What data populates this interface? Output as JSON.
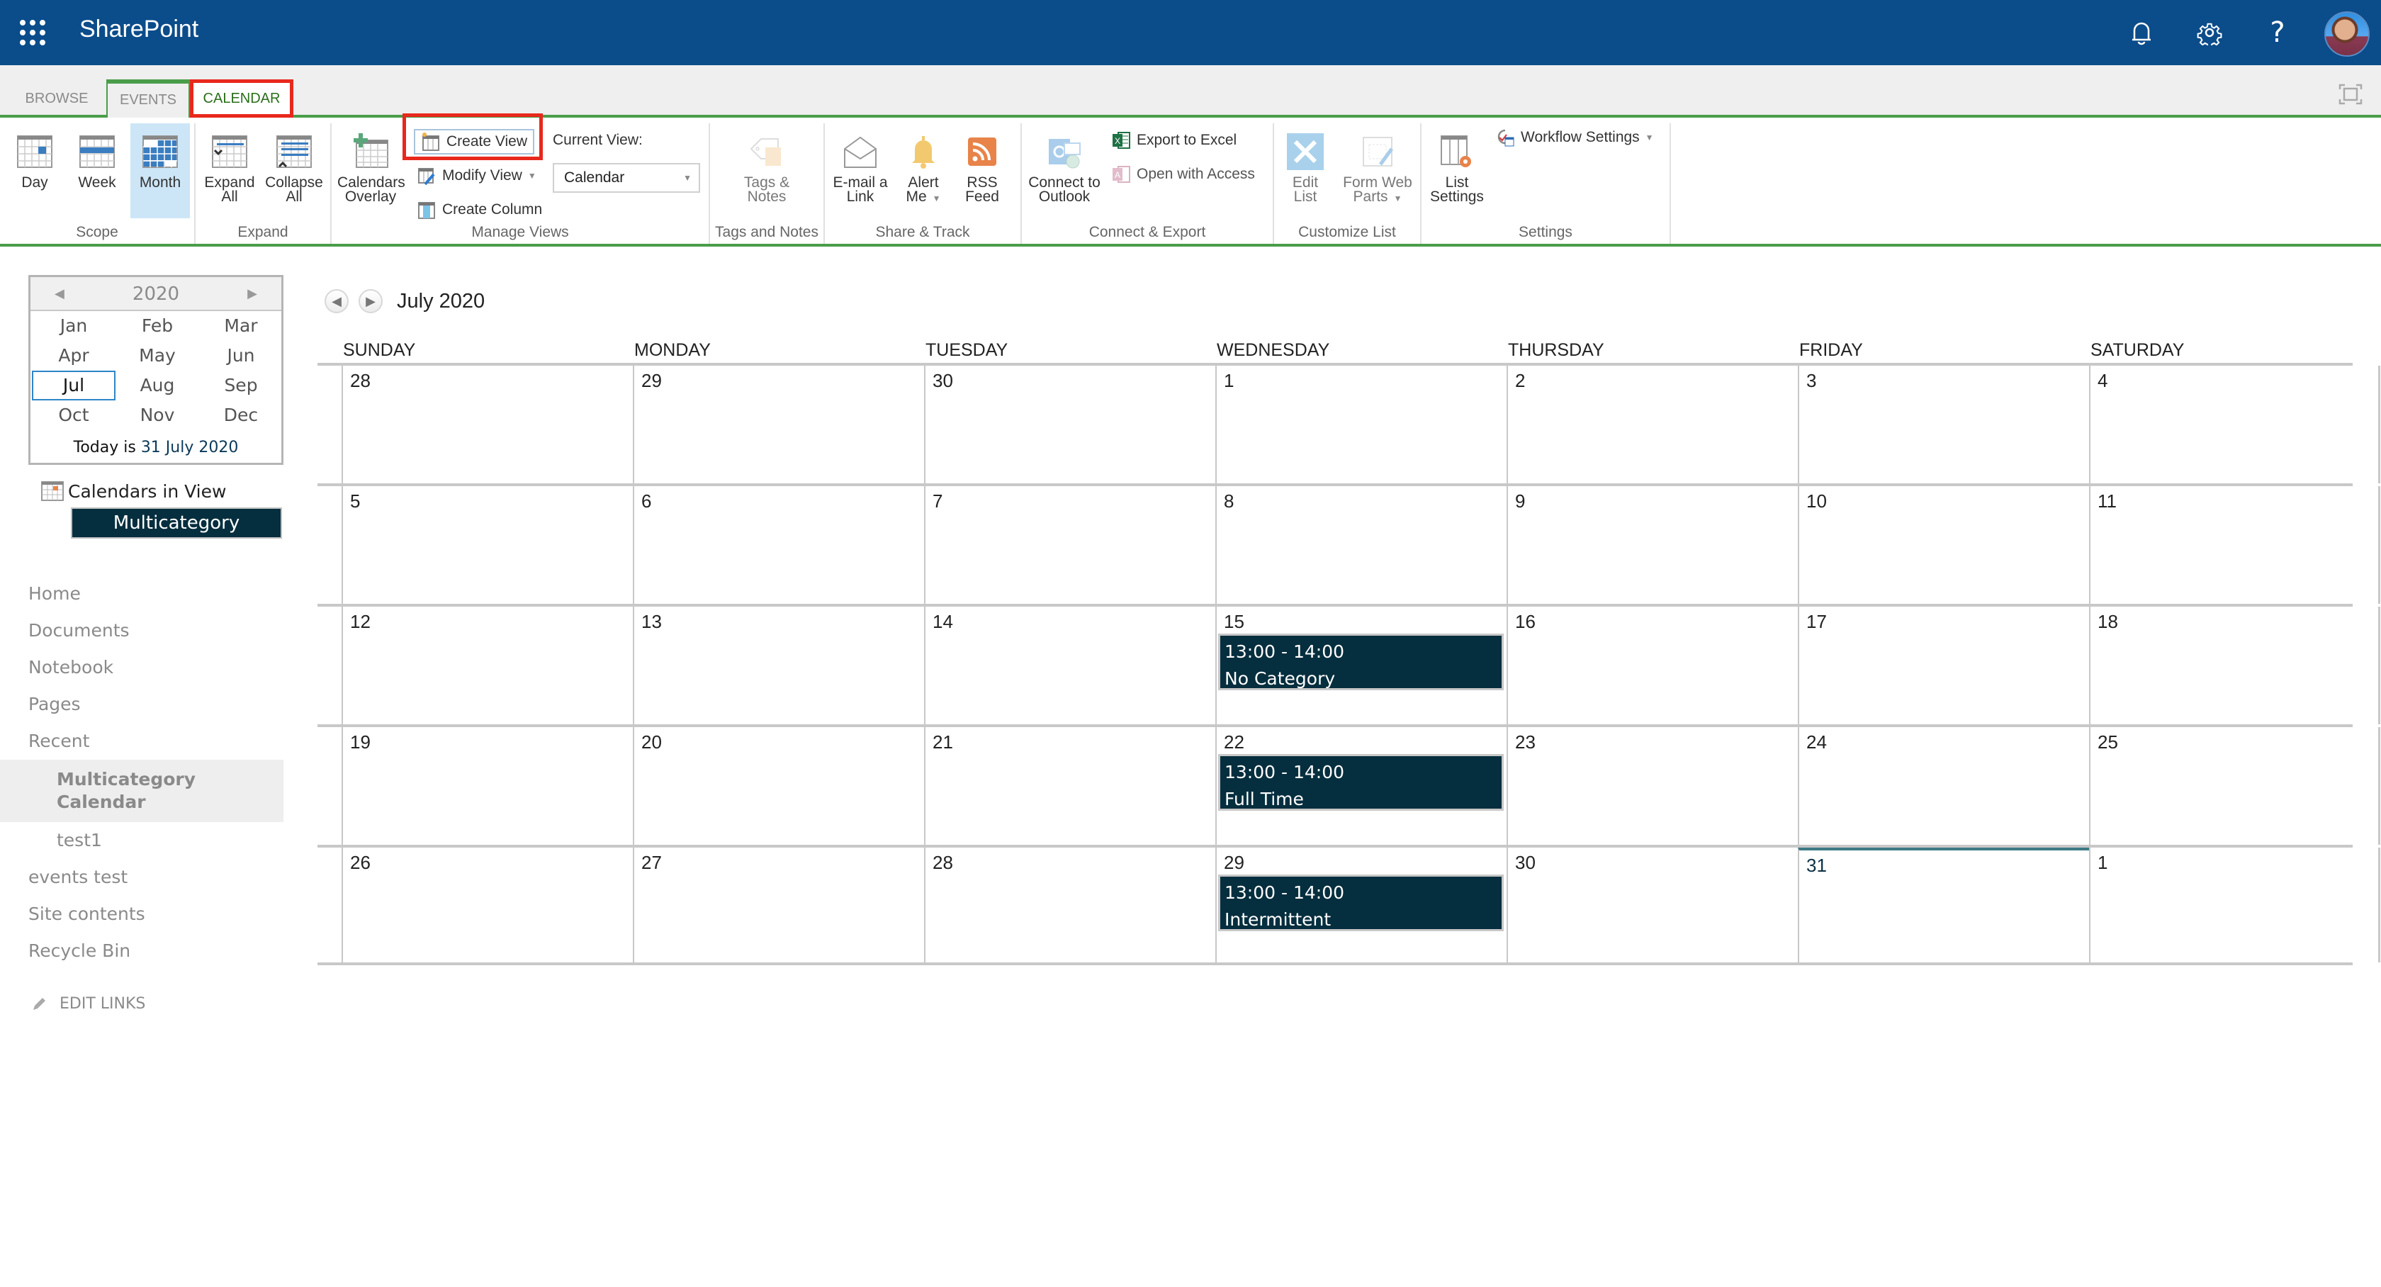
{
  "app": {
    "brand": "SharePoint",
    "suite_icons": [
      "bell-icon",
      "gear-icon",
      "help-icon"
    ],
    "help_glyph": "?"
  },
  "tabs": [
    {
      "label": "BROWSE",
      "active": false
    },
    {
      "label": "EVENTS",
      "active": false
    },
    {
      "label": "CALENDAR",
      "active": true
    }
  ],
  "ribbon": {
    "groups": {
      "scope": "Scope",
      "expand": "Expand",
      "manage_views": "Manage Views",
      "tags_notes": "Tags and Notes",
      "share_track": "Share & Track",
      "connect_export": "Connect & Export",
      "customize_list": "Customize List",
      "settings": "Settings"
    },
    "scope": {
      "day": "Day",
      "week": "Week",
      "month": "Month",
      "selected": "Month"
    },
    "expand": {
      "expand_all_1": "Expand",
      "expand_all_2": "All",
      "collapse_all_1": "Collapse",
      "collapse_all_2": "All"
    },
    "manage_views": {
      "calendars_overlay_1": "Calendars",
      "calendars_overlay_2": "Overlay",
      "create_view": "Create View",
      "modify_view": "Modify View",
      "create_column": "Create Column",
      "current_view_label": "Current View:",
      "current_view_value": "Calendar"
    },
    "tags_notes": {
      "line1": "Tags &",
      "line2": "Notes"
    },
    "share_track": {
      "email_1": "E-mail a",
      "email_2": "Link",
      "alert_1": "Alert",
      "alert_2": "Me",
      "rss_1": "RSS",
      "rss_2": "Feed"
    },
    "connect_export": {
      "outlook_1": "Connect to",
      "outlook_2": "Outlook",
      "export_excel": "Export to Excel",
      "open_access": "Open with Access"
    },
    "customize_list": {
      "edit_list_1": "Edit",
      "edit_list_2": "List",
      "form_web_parts_1": "Form Web",
      "form_web_parts_2": "Parts"
    },
    "settings": {
      "list_settings_1": "List",
      "list_settings_2": "Settings",
      "workflow_settings": "Workflow Settings"
    }
  },
  "datepicker": {
    "year": "2020",
    "months": [
      "Jan",
      "Feb",
      "Mar",
      "Apr",
      "May",
      "Jun",
      "Jul",
      "Aug",
      "Sep",
      "Oct",
      "Nov",
      "Dec"
    ],
    "selected_month": "Jul",
    "today_prefix": "Today is ",
    "today_value": "31 July 2020"
  },
  "calendars_in_view": {
    "label": "Calendars in View",
    "items": [
      "Multicategory Calendar"
    ]
  },
  "quick_launch": {
    "items": [
      {
        "label": "Home",
        "level": 0
      },
      {
        "label": "Documents",
        "level": 0
      },
      {
        "label": "Notebook",
        "level": 0
      },
      {
        "label": "Pages",
        "level": 0
      },
      {
        "label": "Recent",
        "level": 0
      },
      {
        "label": "Multicategory Calendar",
        "level": 1,
        "selected": true
      },
      {
        "label": "test1",
        "level": 1
      },
      {
        "label": "events test",
        "level": 0
      },
      {
        "label": "Site contents",
        "level": 0
      },
      {
        "label": "Recycle Bin",
        "level": 0
      }
    ],
    "edit_links": "EDIT LINKS"
  },
  "calendar": {
    "title": "July 2020",
    "day_headers": [
      "SUNDAY",
      "MONDAY",
      "TUESDAY",
      "WEDNESDAY",
      "THURSDAY",
      "FRIDAY",
      "SATURDAY"
    ],
    "today": "31",
    "weeks": [
      [
        "28",
        "29",
        "30",
        "1",
        "2",
        "3",
        "4"
      ],
      [
        "5",
        "6",
        "7",
        "8",
        "9",
        "10",
        "11"
      ],
      [
        "12",
        "13",
        "14",
        "15",
        "16",
        "17",
        "18"
      ],
      [
        "19",
        "20",
        "21",
        "22",
        "23",
        "24",
        "25"
      ],
      [
        "26",
        "27",
        "28",
        "29",
        "30",
        "31",
        "1"
      ]
    ],
    "events": [
      {
        "week": 2,
        "day": 3,
        "time": "13:00 - 14:00",
        "title": "No Category"
      },
      {
        "week": 3,
        "day": 3,
        "time": "13:00 - 14:00",
        "title": "Full Time"
      },
      {
        "week": 4,
        "day": 3,
        "time": "13:00 - 14:00",
        "title": "Intermittent"
      }
    ],
    "event_color": "#052e3e"
  }
}
